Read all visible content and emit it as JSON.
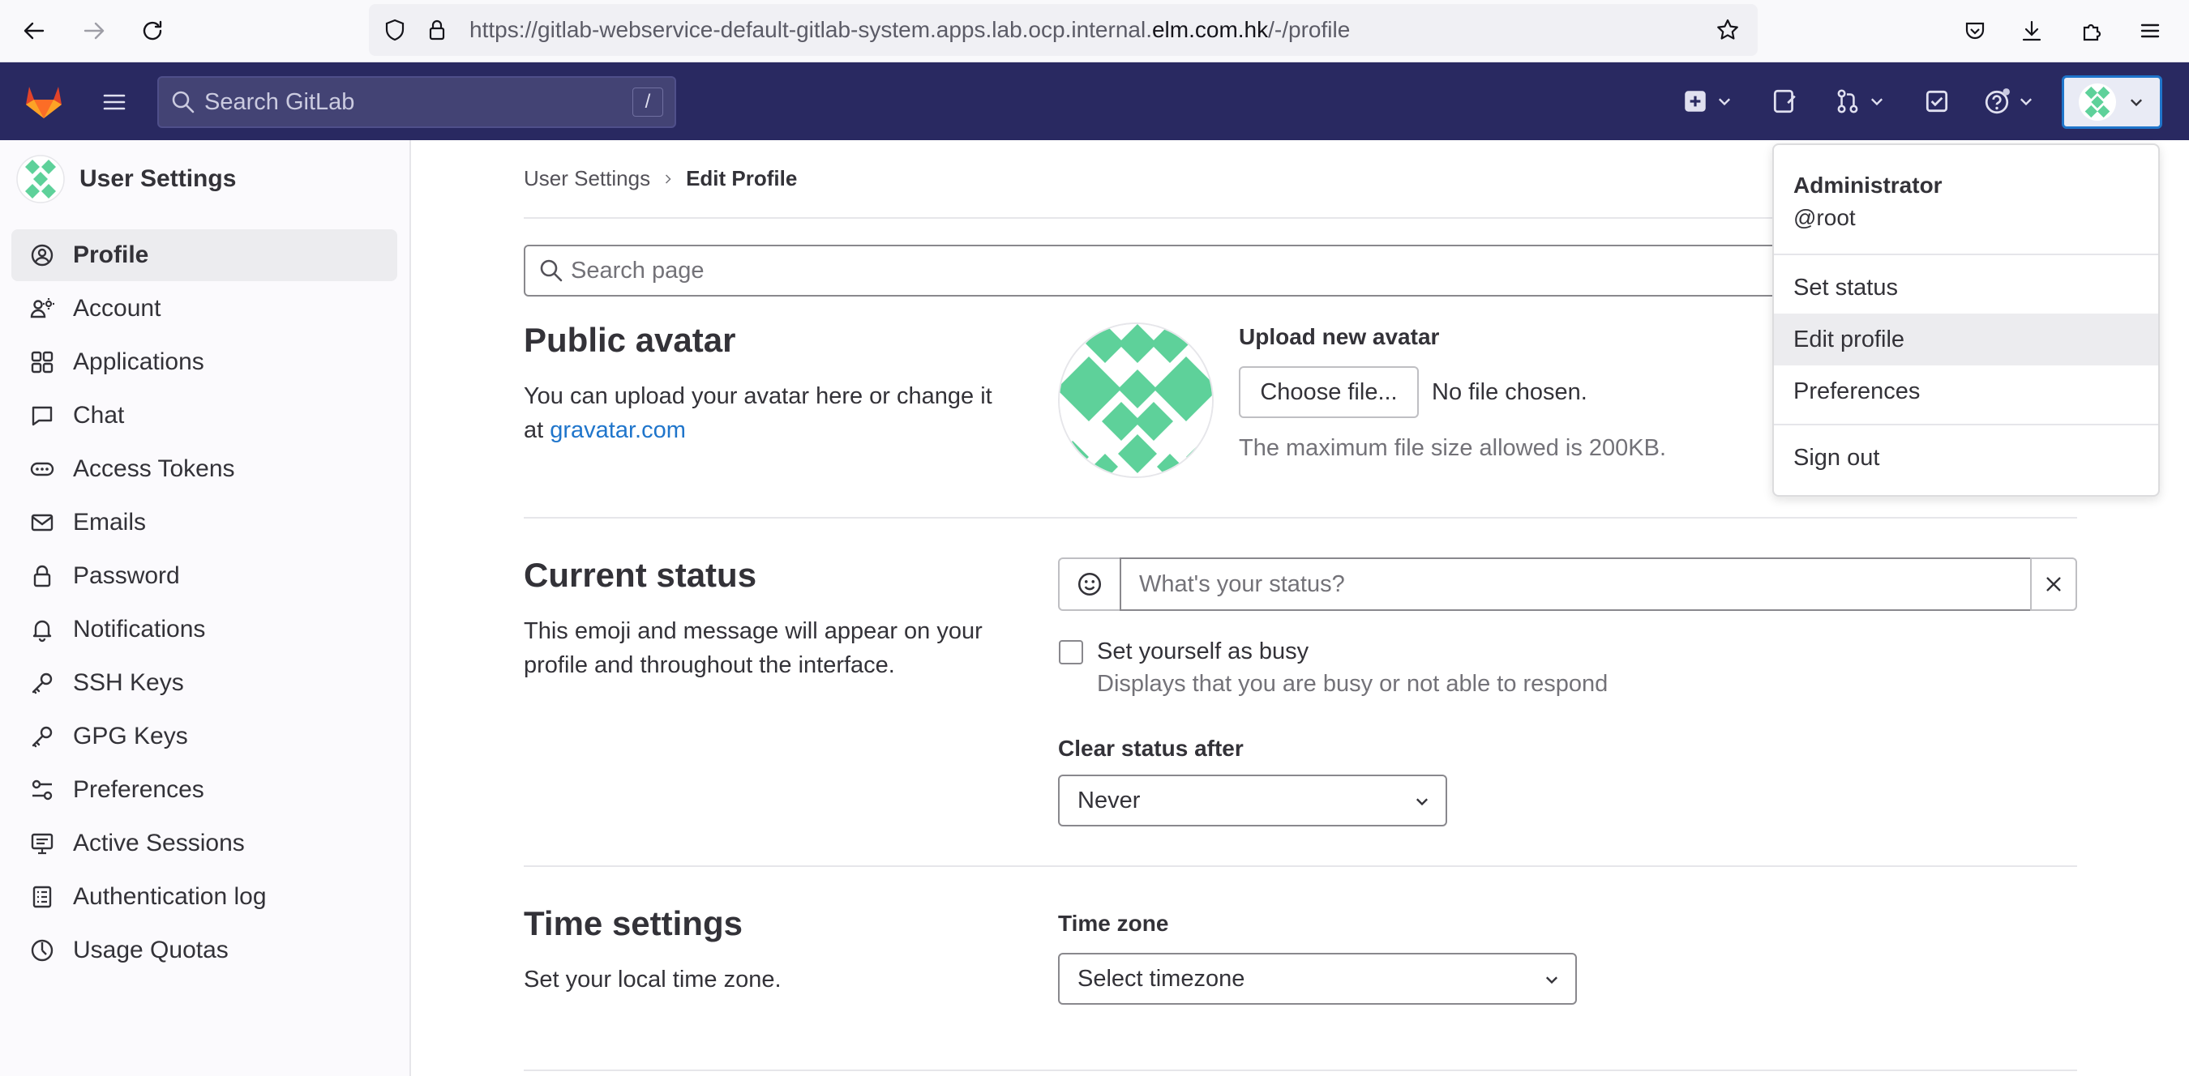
{
  "browser": {
    "url_prefix": "https://gitlab-webservice-default-gitlab-system.apps.lab.ocp.internal.",
    "url_domain": "elm.com.hk",
    "url_suffix": "/-/profile"
  },
  "topnav": {
    "search_placeholder": "Search GitLab",
    "search_shortcut": "/"
  },
  "sidebar": {
    "title": "User Settings",
    "items": [
      {
        "label": "Profile",
        "icon": "profile-icon",
        "active": true
      },
      {
        "label": "Account",
        "icon": "account-icon"
      },
      {
        "label": "Applications",
        "icon": "applications-icon"
      },
      {
        "label": "Chat",
        "icon": "chat-icon"
      },
      {
        "label": "Access Tokens",
        "icon": "token-icon"
      },
      {
        "label": "Emails",
        "icon": "mail-icon"
      },
      {
        "label": "Password",
        "icon": "lock-icon"
      },
      {
        "label": "Notifications",
        "icon": "bell-icon"
      },
      {
        "label": "SSH Keys",
        "icon": "key-icon"
      },
      {
        "label": "GPG Keys",
        "icon": "key-icon"
      },
      {
        "label": "Preferences",
        "icon": "preferences-icon"
      },
      {
        "label": "Active Sessions",
        "icon": "monitor-icon"
      },
      {
        "label": "Authentication log",
        "icon": "log-icon"
      },
      {
        "label": "Usage Quotas",
        "icon": "quota-icon"
      }
    ]
  },
  "breadcrumb": {
    "parent": "User Settings",
    "current": "Edit Profile"
  },
  "page_search": {
    "placeholder": "Search page"
  },
  "avatar_section": {
    "title": "Public avatar",
    "desc": "You can upload your avatar here or change it at",
    "link": "gravatar.com",
    "upload_label": "Upload new avatar",
    "choose_button": "Choose file...",
    "no_file": "No file chosen.",
    "max_size": "The maximum file size allowed is 200KB."
  },
  "status_section": {
    "title": "Current status",
    "desc": "This emoji and message will appear on your profile and throughout the interface.",
    "placeholder": "What's your status?",
    "busy_label": "Set yourself as busy",
    "busy_help": "Displays that you are busy or not able to respond",
    "clear_label": "Clear status after",
    "clear_value": "Never"
  },
  "time_section": {
    "title": "Time settings",
    "desc": "Set your local time zone.",
    "tz_label": "Time zone",
    "tz_value": "Select timezone"
  },
  "user_dropdown": {
    "name": "Administrator",
    "username": "@root",
    "items": [
      "Set status",
      "Edit profile",
      "Preferences",
      "Sign out"
    ]
  },
  "colors": {
    "nav_bg": "#292961",
    "accent": "#1f75cb",
    "avatar_green": "#5ed19a"
  }
}
